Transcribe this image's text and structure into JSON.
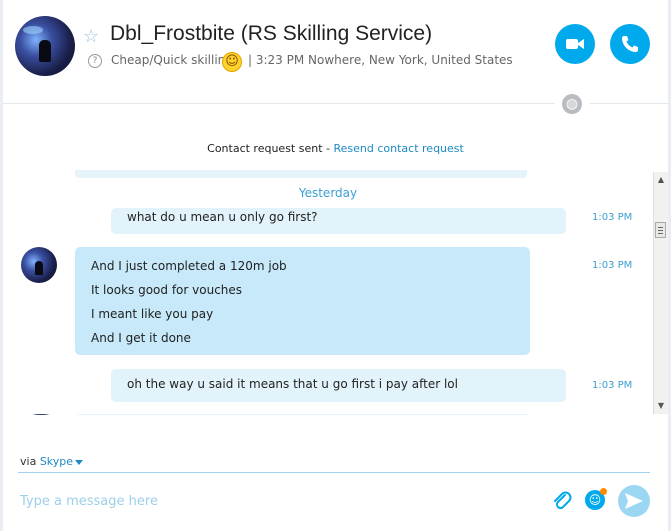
{
  "header": {
    "contact_name": "Dbl_Frostbite (RS Skilling Service)",
    "mood": "Cheap/Quick skilling",
    "location": "| 3:23 PM Nowhere, New York, United States",
    "icons": [
      "star-icon",
      "help-icon",
      "smiley-icon",
      "video-call-icon",
      "phone-call-icon",
      "globe-icon"
    ]
  },
  "notice": {
    "text": "Contact request sent - ",
    "link": "Resend contact request"
  },
  "chat": {
    "date_separator": "Yesterday",
    "messages": [
      {
        "direction": "outgoing",
        "text": "what do u mean u only go first?",
        "time": "1:03 PM"
      },
      {
        "direction": "incoming",
        "lines": [
          "And I just completed a 120m job",
          "It looks good for vouches",
          "I meant like you pay",
          "And I get it done"
        ],
        "time": "1:03 PM"
      },
      {
        "direction": "outgoing",
        "text": "oh the way u said it means that u go first i pay after lol",
        "time": "1:03 PM"
      }
    ]
  },
  "composer": {
    "via_label": "via",
    "via_service": "Skype",
    "placeholder": "Type a message here",
    "icons": [
      "attach-icon",
      "emoticon-icon",
      "send-icon"
    ]
  },
  "colors": {
    "accent": "#00a8ec",
    "link": "#1e8ac4",
    "incoming_bubble": "#c7e9f9",
    "outgoing_bubble": "#e3f3fb"
  }
}
